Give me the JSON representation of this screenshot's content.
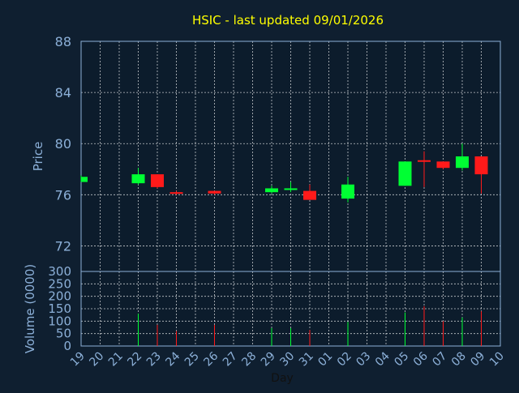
{
  "chart_data": {
    "type": "candlestick",
    "title": "HSIC - last updated 09/01/2026",
    "xlabel": "Day",
    "price_panel": {
      "ylabel": "Price",
      "ylim": [
        70,
        88
      ],
      "yticks": [
        "88",
        "84",
        "80",
        "76",
        "72"
      ],
      "ytick_values": [
        88,
        84,
        80,
        76,
        72
      ]
    },
    "volume_panel": {
      "ylabel": "Volume (0000)",
      "ylim": [
        0,
        300
      ],
      "yticks": [
        "300",
        "250",
        "200",
        "150",
        "100",
        "50",
        "0"
      ],
      "ytick_values": [
        300,
        250,
        200,
        150,
        100,
        50,
        0
      ]
    },
    "categories": [
      "19",
      "20",
      "21",
      "22",
      "23",
      "24",
      "25",
      "26",
      "27",
      "28",
      "29",
      "30",
      "31",
      "01",
      "02",
      "03",
      "04",
      "05",
      "06",
      "07",
      "08",
      "09",
      "10"
    ],
    "grid": true,
    "colors": {
      "background": "#0f1f30",
      "plot": "#0c1c2c",
      "up": "#00ff33",
      "down": "#ff1a1a",
      "axis": "#8cb0d8",
      "title": "#ffff00"
    },
    "candles": [
      {
        "day": "19",
        "open": 77.0,
        "high": 77.5,
        "low": 77.0,
        "close": 77.4,
        "volume": 0
      },
      {
        "day": "22",
        "open": 76.9,
        "high": 78.1,
        "low": 76.8,
        "close": 77.6,
        "volume": 130
      },
      {
        "day": "23",
        "open": 77.6,
        "high": 77.6,
        "low": 76.5,
        "close": 76.6,
        "volume": 85
      },
      {
        "day": "24",
        "open": 76.2,
        "high": 76.3,
        "low": 76.0,
        "close": 76.1,
        "volume": 60
      },
      {
        "day": "26",
        "open": 76.3,
        "high": 76.3,
        "low": 76.0,
        "close": 76.1,
        "volume": 85
      },
      {
        "day": "29",
        "open": 76.2,
        "high": 76.7,
        "low": 76.1,
        "close": 76.5,
        "volume": 72
      },
      {
        "day": "30",
        "open": 76.4,
        "high": 77.0,
        "low": 76.2,
        "close": 76.5,
        "volume": 72
      },
      {
        "day": "31",
        "open": 76.3,
        "high": 76.8,
        "low": 75.6,
        "close": 75.6,
        "volume": 65
      },
      {
        "day": "02",
        "open": 75.7,
        "high": 77.4,
        "low": 75.4,
        "close": 76.8,
        "volume": 97
      },
      {
        "day": "05",
        "open": 76.7,
        "high": 78.6,
        "low": 76.7,
        "close": 78.6,
        "volume": 135
      },
      {
        "day": "06",
        "open": 78.7,
        "high": 79.4,
        "low": 76.6,
        "close": 78.6,
        "volume": 160
      },
      {
        "day": "07",
        "open": 78.6,
        "high": 78.6,
        "low": 78.0,
        "close": 78.1,
        "volume": 100
      },
      {
        "day": "08",
        "open": 78.1,
        "high": 80.0,
        "low": 77.9,
        "close": 79.0,
        "volume": 115
      },
      {
        "day": "09",
        "open": 79.0,
        "high": 79.0,
        "low": 76.1,
        "close": 77.6,
        "volume": 140
      }
    ]
  }
}
